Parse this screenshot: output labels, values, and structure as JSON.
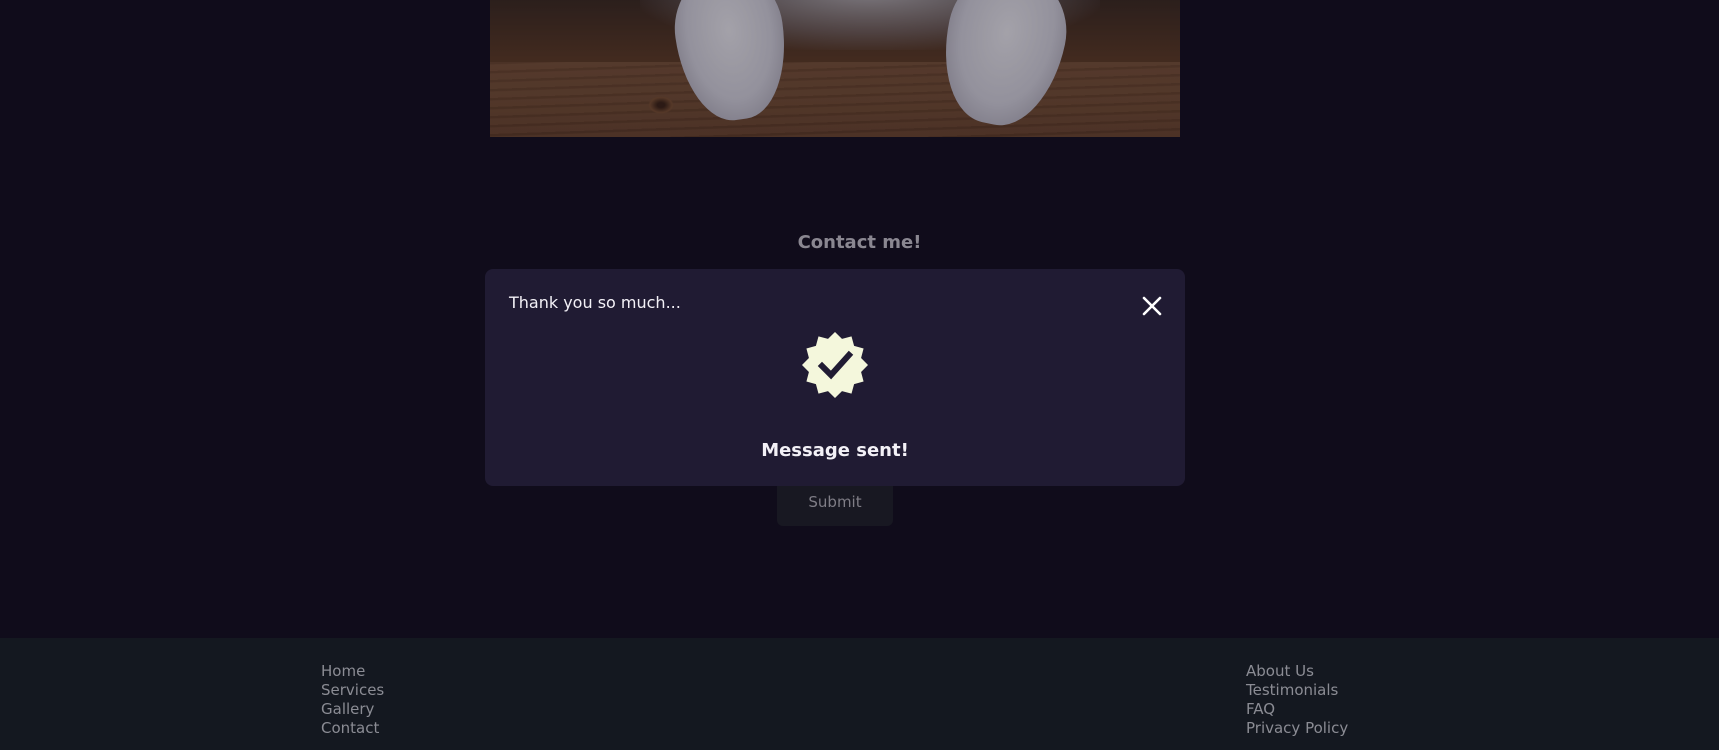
{
  "hero": {
    "image_alt": "cat paws on wooden table"
  },
  "contact": {
    "heading": "Contact me!",
    "submit_label": "Submit"
  },
  "modal": {
    "title": "Thank you so much...",
    "message": "Message sent!",
    "close_icon": "close-icon",
    "badge_icon": "verified-badge-icon"
  },
  "footer": {
    "left_links": [
      "Home",
      "Services",
      "Gallery",
      "Contact"
    ],
    "right_links": [
      "About Us",
      "Testimonials",
      "FAQ",
      "Privacy Policy"
    ]
  },
  "colors": {
    "background": "#100c1b",
    "modal_background": "#201b33",
    "footer_background": "#141820",
    "badge": "#f4f7dc",
    "link": "#8b8c94"
  }
}
